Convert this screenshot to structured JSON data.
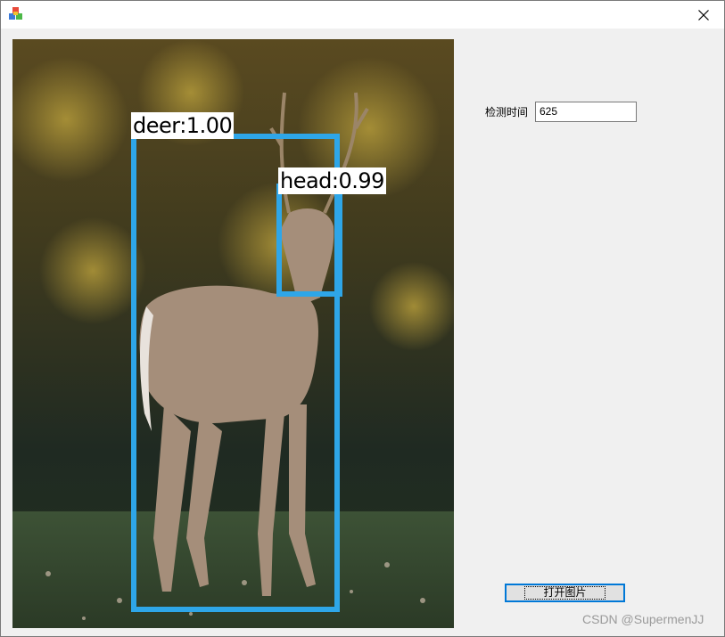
{
  "window": {
    "app_icon": "app-cubes-icon",
    "close_icon": "close-icon"
  },
  "detections": [
    {
      "label": "deer:1.00",
      "color": "#2ea6e8"
    },
    {
      "label": "head:0.99",
      "color": "#2ea6e8"
    }
  ],
  "detect_time": {
    "label": "检测时间",
    "value": "625"
  },
  "open_button": {
    "label": "打开图片"
  },
  "watermark": "CSDN @SupermenJJ"
}
